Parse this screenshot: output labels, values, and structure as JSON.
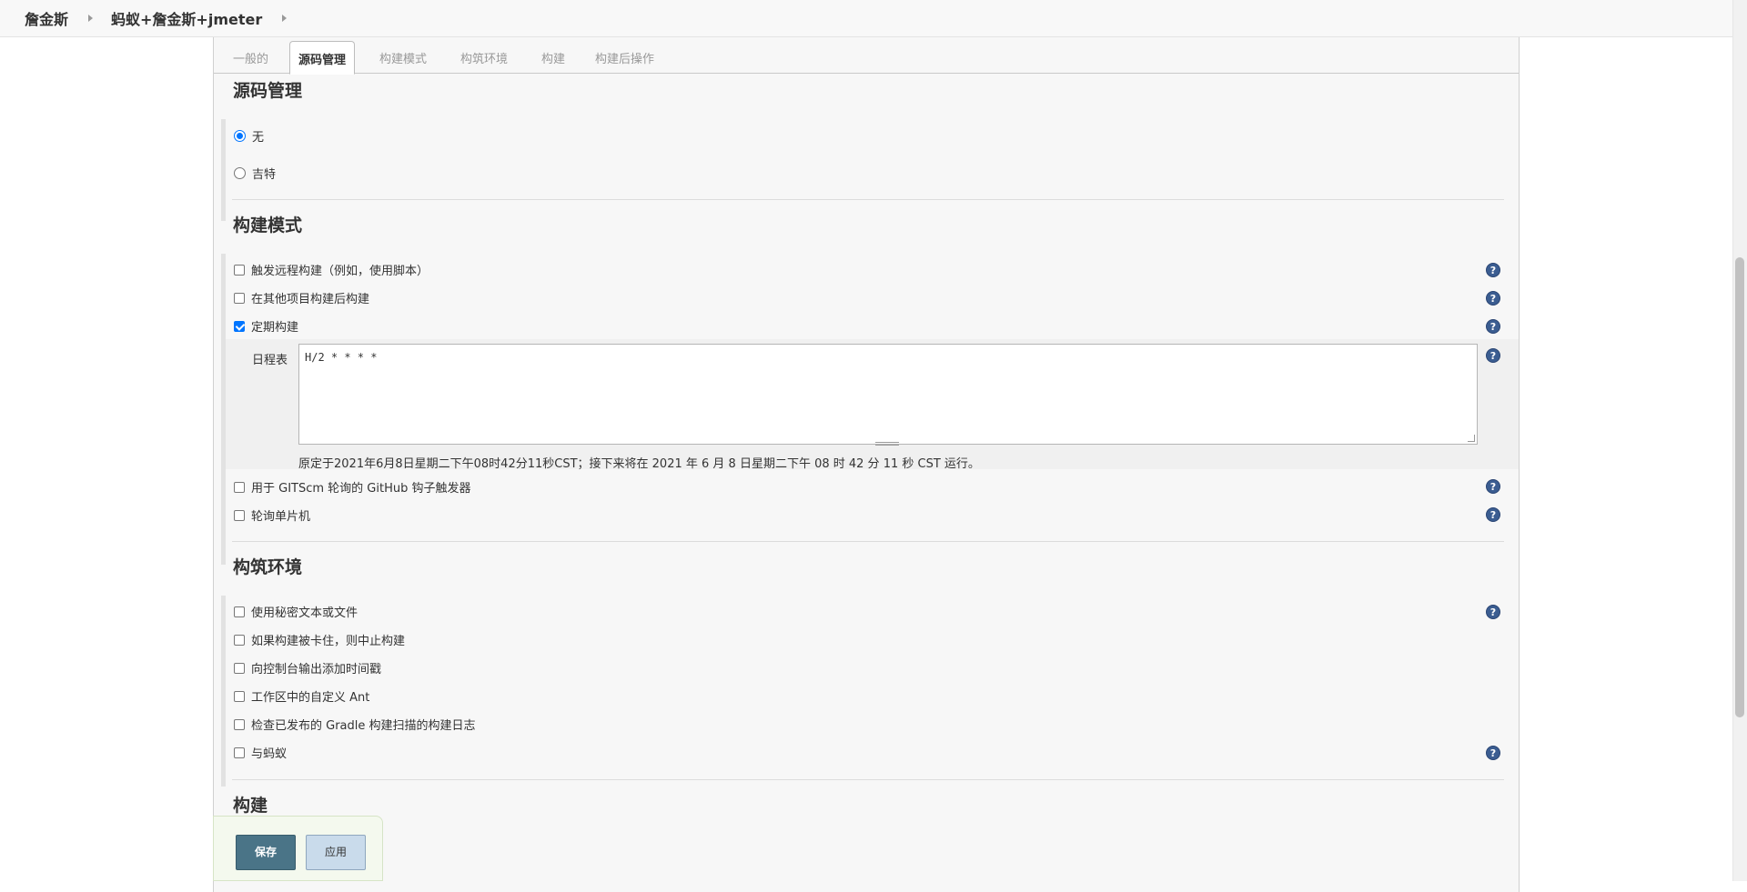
{
  "breadcrumb": [
    "詹金斯",
    "蚂蚁+詹金斯+jmeter"
  ],
  "tabs": [
    "一般的",
    "源码管理",
    "构建模式",
    "构筑环境",
    "构建",
    "构建后操作"
  ],
  "active_tab": "源码管理",
  "scm": {
    "title": "源码管理",
    "options": [
      {
        "label": "无",
        "selected": true
      },
      {
        "label": "吉特",
        "selected": false
      }
    ]
  },
  "triggers": {
    "title": "构建模式",
    "items": [
      {
        "label": "触发远程构建（例如，使用脚本）",
        "checked": false,
        "help": true
      },
      {
        "label": "在其他项目构建后构建",
        "checked": false,
        "help": true
      },
      {
        "label": "定期构建",
        "checked": true,
        "help": true
      },
      {
        "label": "用于 GITScm 轮询的 GitHub 钩子触发器",
        "checked": false,
        "help": true
      },
      {
        "label": "轮询单片机",
        "checked": false,
        "help": true
      }
    ],
    "schedule": {
      "label": "日程表",
      "value": "H/2 * * * *",
      "note": "原定于2021年6月8日星期二下午08时42分11秒CST；接下来将在 2021 年 6 月 8 日星期二下午 08 时 42 分 11 秒 CST 运行。"
    }
  },
  "environment": {
    "title": "构筑环境",
    "items": [
      {
        "label": "使用秘密文本或文件",
        "checked": false,
        "help": true
      },
      {
        "label": "如果构建被卡住，则中止构建",
        "checked": false,
        "help": false
      },
      {
        "label": "向控制台输出添加时间戳",
        "checked": false,
        "help": false
      },
      {
        "label": "工作区中的自定义 Ant",
        "checked": false,
        "help": false
      },
      {
        "label": "检查已发布的 Gradle 构建扫描的构建日志",
        "checked": false,
        "help": false
      },
      {
        "label": "与蚂蚁",
        "checked": false,
        "help": true
      }
    ]
  },
  "build": {
    "title": "构建"
  },
  "help_glyph": "?",
  "actions": {
    "save": "保存",
    "apply": "应用"
  }
}
